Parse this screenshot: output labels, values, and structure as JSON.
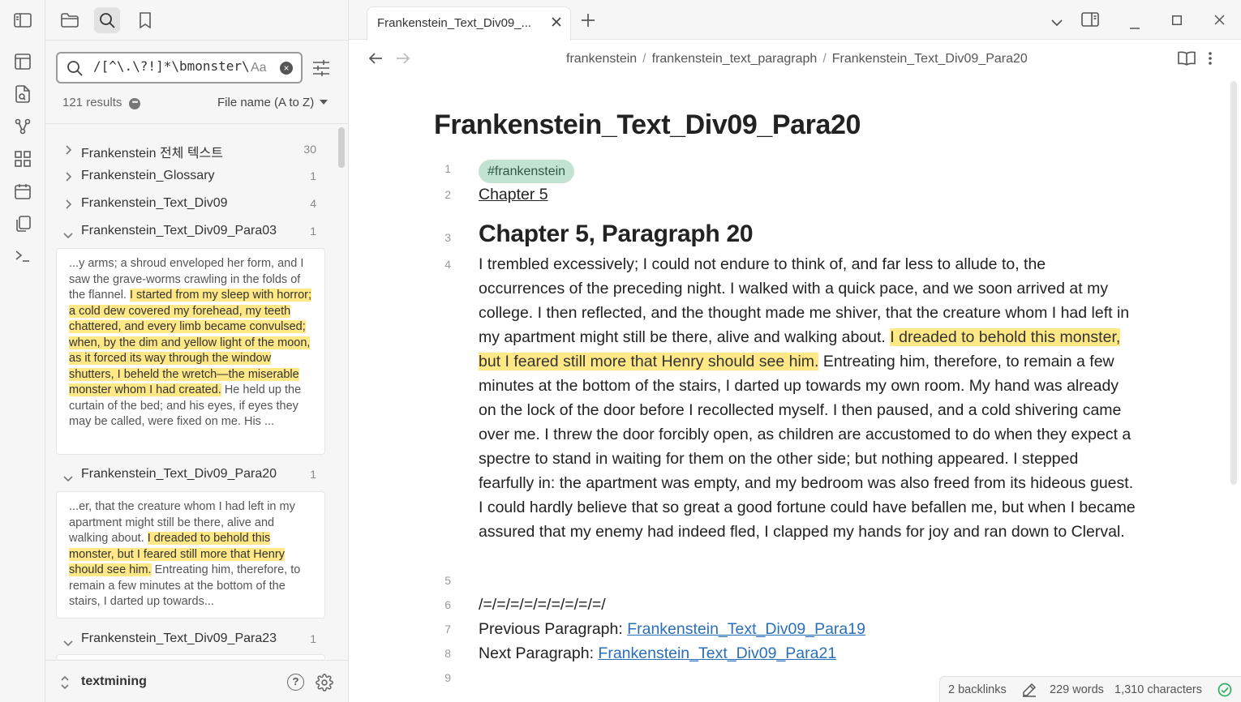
{
  "ribbon": {
    "icons": [
      "sidebar-toggle-icon",
      "layout-icon",
      "new-note-icon",
      "graph-icon",
      "dashboard-icon",
      "calendar-icon",
      "copy-icon",
      "terminal-icon"
    ]
  },
  "sidebar": {
    "tabs": [
      "file-explorer-icon",
      "search-icon",
      "bookmark-icon"
    ],
    "search": {
      "value": "/[^\\.\\?!]*\\bmonster\\b[^\\.\\?",
      "match_case_label": "Aa"
    },
    "results_count": "121 results",
    "sort_label": "File name (A to Z)",
    "results": [
      {
        "name": "Frankenstein 전체 텍스트",
        "count": "30",
        "expanded": false
      },
      {
        "name": "Frankenstein_Glossary",
        "count": "1",
        "expanded": false
      },
      {
        "name": "Frankenstein_Text_Div09",
        "count": "4",
        "expanded": false
      },
      {
        "name": "Frankenstein_Text_Div09_Para03",
        "count": "1",
        "expanded": true,
        "snippet_before": "...y arms; a shroud enveloped her form, and I saw the grave-worms crawling in the folds of the flannel. ",
        "snippet_match": "I started from my sleep with horror; a cold dew covered my forehead, my teeth chattered, and every limb became convulsed; when, by the dim and yellow light of the moon, as it forced its way through the window shutters, I beheld the wretch—the miserable monster whom I had created.",
        "snippet_after": " He held up the curtain of the bed; and his eyes, if eyes they may be called, were fixed on me. His ..."
      },
      {
        "name": "Frankenstein_Text_Div09_Para20",
        "count": "1",
        "expanded": true,
        "snippet_before": "...er, that the creature whom I had left in my apartment might still be there, alive and walking about. ",
        "snippet_match": "I dreaded to behold this monster, but I feared still more that Henry should see him.",
        "snippet_after": " Entreating him, therefore, to remain a few minutes at the bottom of the stairs, I darted up towards..."
      },
      {
        "name": "Frankenstein_Text_Div09_Para23",
        "count": "1",
        "expanded": true
      }
    ],
    "footer": {
      "vault_name": "textmining",
      "help_label": "?"
    }
  },
  "tab": {
    "title": "Frankenstein_Text_Div09_..."
  },
  "breadcrumb": [
    "frankenstein",
    "frankenstein_text_paragraph",
    "Frankenstein_Text_Div09_Para20"
  ],
  "note": {
    "title": "Frankenstein_Text_Div09_Para20",
    "line_numbers": [
      "1",
      "2",
      "3",
      "4",
      "5",
      "6",
      "7",
      "8",
      "9"
    ],
    "tag": "#frankenstein",
    "chapter_link": "Chapter 5",
    "heading": "Chapter 5, Paragraph 20",
    "para_before": "I trembled excessively; I could not endure to think of, and far less to allude to, the occurrences of the preceding night. I walked with a quick pace, and we soon arrived at my college. I then reflected, and the thought made me shiver, that the creature whom I had left in my apartment might still be there, alive and walking about. ",
    "para_match": "I dreaded to behold this monster, but I feared still more that Henry should see him.",
    "para_after": " Entreating him, therefore, to remain a few minutes at the bottom of the stairs, I darted up towards my own room. My hand was already on the lock of the door before I recollected myself. I then paused, and a cold shivering came over me. I threw the door forcibly open, as children are accustomed to do when they expect a spectre to stand in waiting for them on the other side; but nothing appeared. I stepped fearfully in: the apartment was empty, and my bedroom was also freed from its hideous guest. I could hardly believe that so great a good fortune could have befallen me, but when I became assured that my enemy had indeed fled, I clapped my hands for joy and ran down to Clerval.",
    "divider": "/=/=/=/=/=/=/=/=/=/",
    "prev_label": "Previous Paragraph: ",
    "prev_link": "Frankenstein_Text_Div09_Para19",
    "next_label": "Next Paragraph: ",
    "next_link": "Frankenstein_Text_Div09_Para21"
  },
  "status": {
    "backlinks": "2 backlinks",
    "words": "229 words",
    "characters": "1,310 characters"
  },
  "colors": {
    "highlight": "#ffe885",
    "tag_bg": "#c3e3d2",
    "link": "#2a6fb8",
    "sync_ok": "#2fae5f"
  }
}
